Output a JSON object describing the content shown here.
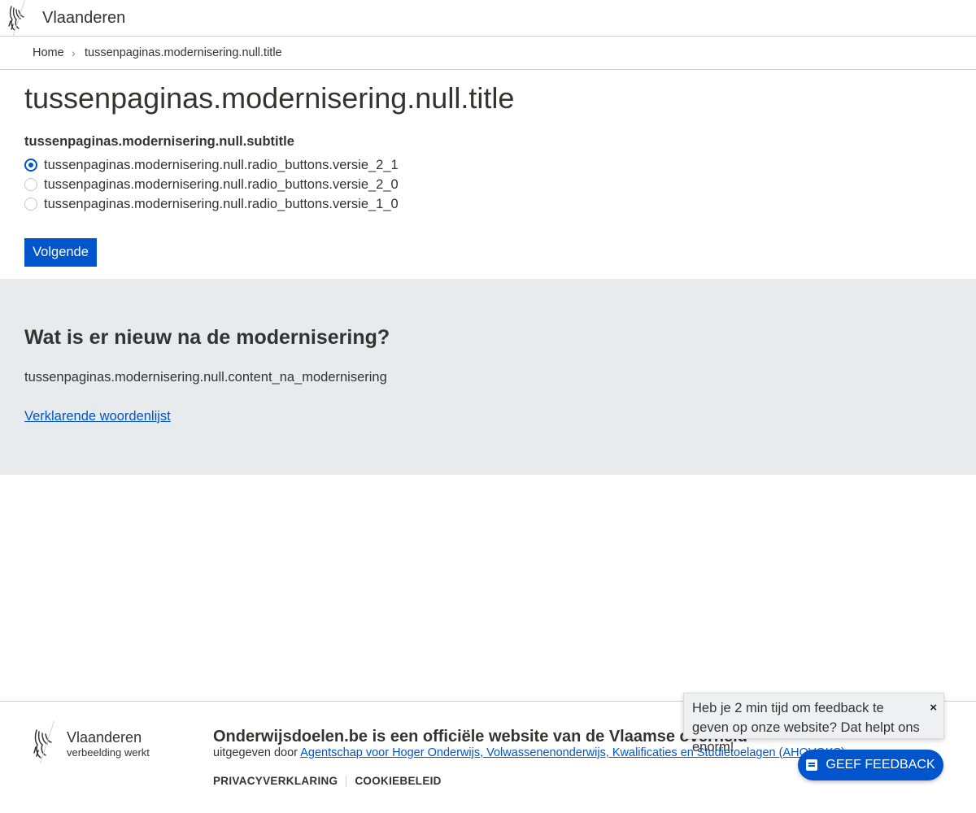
{
  "header": {
    "brand": "Vlaanderen",
    "logo_icon": "flemish-lion-icon"
  },
  "breadcrumb": {
    "home": "Home",
    "separator": "›",
    "current": "tussenpaginas.modernisering.null.title"
  },
  "main": {
    "title": "tussenpaginas.modernisering.null.title",
    "subtitle": "tussenpaginas.modernisering.null.subtitle",
    "options": [
      {
        "label": "tussenpaginas.modernisering.null.radio_buttons.versie_2_1",
        "checked": true
      },
      {
        "label": "tussenpaginas.modernisering.null.radio_buttons.versie_2_0",
        "checked": false
      },
      {
        "label": "tussenpaginas.modernisering.null.radio_buttons.versie_1_0",
        "checked": false
      }
    ],
    "next_label": "Volgende"
  },
  "info": {
    "title": "Wat is er nieuw na de modernisering?",
    "content": "tussenpaginas.modernisering.null.content_na_modernisering",
    "link": "Verklarende woordenlijst"
  },
  "footer": {
    "brand": "Vlaanderen",
    "tagline": "verbeelding werkt",
    "heading": "Onderwijsdoelen.be is een officiële website van de Vlaamse overheid",
    "published_prefix": "uitgegeven door ",
    "published_link": "Agentschap voor Hoger Onderwijs, Volwassenenonderwijs, Kwalificaties en Studietoelagen (AHOVOKS)",
    "links": [
      "PRIVACYVERKLARING",
      "COOKIEBELEID"
    ]
  },
  "feedback": {
    "message": "Heb je 2 min tijd om feedback te geven op onze website? Dat helpt ons enorm!",
    "close": "×",
    "button_label": "GEEF FEEDBACK"
  },
  "colors": {
    "primary": "#0055cc",
    "section_bg": "#e8ebee",
    "text": "#333332",
    "border": "#cbd2da"
  }
}
